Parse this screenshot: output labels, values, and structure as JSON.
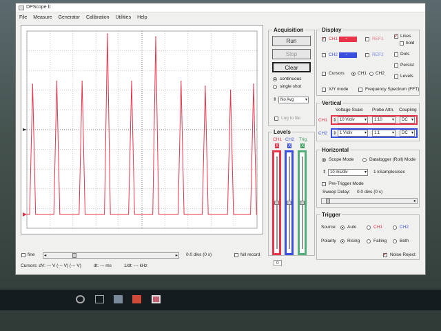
{
  "window": {
    "title": "DPScope II"
  },
  "menu": [
    "File",
    "Measure",
    "Generator",
    "Calibration",
    "Utilities",
    "Help"
  ],
  "acquisition": {
    "title": "Acquisition",
    "run_label": "Run",
    "stop_label": "Stop",
    "clear_label": "Clear",
    "continuous_label": "continuous",
    "single_shot_label": "single shot",
    "avg_value": "No Avg",
    "log_to_file_label": "Log to file"
  },
  "display": {
    "title": "Display",
    "ch1_label": "CH1",
    "ch2_label": "CH2",
    "ref1_label": "REF1",
    "ref2_label": "REF2",
    "lines_label": "Lines",
    "bold_label": "bold",
    "dots_label": "Dots",
    "persist_label": "Persist",
    "levels_label": "Levels",
    "cursors_label": "Cursors",
    "cursor_ch1_label": "CH1",
    "cursor_ch2_label": "CH2",
    "xy_label": "X/Y mode",
    "fft_label": "Frequency Spectrum (FFT)",
    "ch1_color": "#e8334a",
    "ch2_color": "#3a4fe0"
  },
  "vertical": {
    "title": "Vertical",
    "col_voltage": "Voltage Scale",
    "col_probe": "Probe Attn.",
    "col_coupling": "Coupling",
    "ch1_label": "CH1",
    "ch1_scale": "10 V/div",
    "ch1_probe": "1:10",
    "ch1_coupling": "DC",
    "ch2_label": "CH2",
    "ch2_scale": "1 V/div",
    "ch2_probe": "1:1",
    "ch2_coupling": "DC"
  },
  "levels": {
    "title": "Levels",
    "ch1_label": "CH1",
    "ch2_label": "CH2",
    "trig_label": "Trig",
    "x": "X",
    "bottom_value": "0"
  },
  "horizontal": {
    "title": "Horizontal",
    "scope_mode_label": "Scope Mode",
    "datalogger_label": "Datalogger (Roll) Mode",
    "timebase": "10 ms/div",
    "sample_rate": "1 kSamples/sec",
    "pretrigger_label": "Pre-Trigger Mode",
    "sweep_delay_label": "Sweep Delay:",
    "sweep_delay_value": "0.0 divs (0 s)"
  },
  "trigger": {
    "title": "Trigger",
    "source_label": "Source:",
    "auto_label": "Auto",
    "ch1_label": "CH1",
    "ch2_label": "CH2",
    "polarity_label": "Polarity",
    "rising_label": "Rising",
    "falling_label": "Falling",
    "both_label": "Both",
    "noise_reject_label": "Noise Reject"
  },
  "scope_bottom": {
    "fine_label": "fine",
    "offset_value": "0.0 divs (0 s)",
    "full_record_label": "full record"
  },
  "status": {
    "cursors": "Cursors: dV: --- V    (--- V) (--- V)",
    "dt": "dt: --- ms",
    "freq": "1/dt: --- kHz"
  },
  "chart_data": {
    "type": "line",
    "title": "",
    "xlabel": "",
    "ylabel": "",
    "grid": true,
    "xlim": [
      0,
      10
    ],
    "ylim": [
      -5,
      5
    ],
    "series": [
      {
        "color": "#e8334a",
        "baseline": -4.3,
        "pulse_centers": [
          0.25,
          1.3,
          2.4,
          3.5,
          4.55,
          5.6,
          6.7,
          7.75,
          8.85,
          9.85
        ],
        "pulse_peaks": [
          2.3,
          2.45,
          2.45,
          4.85,
          2.45,
          4.7,
          2.45,
          2.2,
          2.0,
          2.3
        ],
        "pulse_half_width": 0.13
      }
    ]
  }
}
